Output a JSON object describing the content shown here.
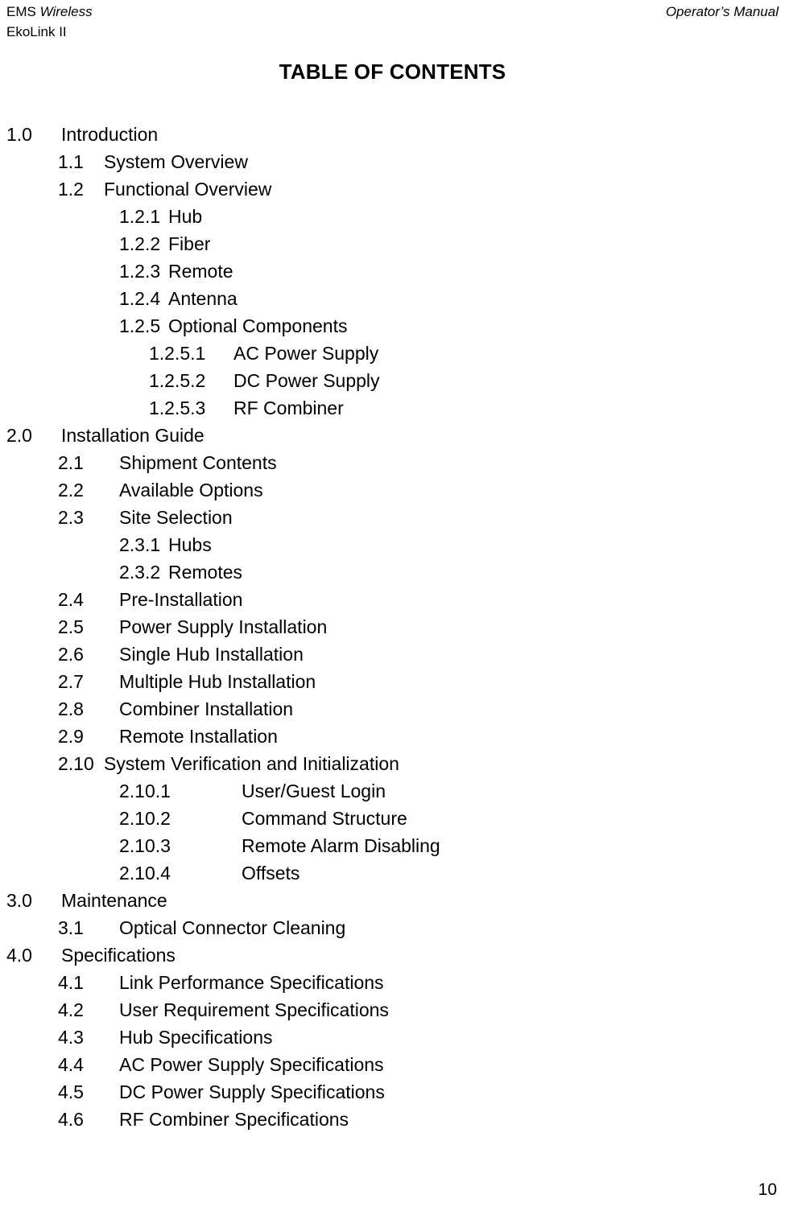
{
  "header": {
    "left_line1_regular": "EMS ",
    "left_line1_italic": "Wireless",
    "left_line2": "EkoLink II",
    "right": "Operator’s Manual"
  },
  "title": "TABLE OF CONTENTS",
  "toc": {
    "entries": [
      {
        "level": 1,
        "number": "1.0",
        "label": "Introduction"
      },
      {
        "level": 2,
        "number": "1.1",
        "label": "System Overview",
        "variant": "tight"
      },
      {
        "level": 2,
        "number": "1.2",
        "label": "Functional Overview",
        "variant": "tight"
      },
      {
        "level": 3,
        "number": "1.2.1",
        "label": "Hub"
      },
      {
        "level": 3,
        "number": "1.2.2",
        "label": "Fiber"
      },
      {
        "level": 3,
        "number": "1.2.3",
        "label": "Remote"
      },
      {
        "level": 3,
        "number": "1.2.4",
        "label": "Antenna"
      },
      {
        "level": 3,
        "number": "1.2.5",
        "label": "Optional Components"
      },
      {
        "level": 4,
        "number": "1.2.5.1",
        "label": "AC Power Supply"
      },
      {
        "level": 4,
        "number": "1.2.5.2",
        "label": "DC Power Supply"
      },
      {
        "level": 4,
        "number": "1.2.5.3",
        "label": "RF Combiner"
      },
      {
        "level": 1,
        "number": "2.0",
        "label": "Installation Guide"
      },
      {
        "level": 2,
        "number": "2.1",
        "label": "Shipment Contents"
      },
      {
        "level": 2,
        "number": "2.2",
        "label": "Available Options"
      },
      {
        "level": 2,
        "number": "2.3",
        "label": "Site Selection"
      },
      {
        "level": 3,
        "number": "2.3.1",
        "label": "Hubs"
      },
      {
        "level": 3,
        "number": "2.3.2",
        "label": "Remotes"
      },
      {
        "level": 2,
        "number": "2.4",
        "label": "Pre-Installation"
      },
      {
        "level": 2,
        "number": "2.5",
        "label": "Power Supply Installation"
      },
      {
        "level": 2,
        "number": "2.6",
        "label": "Single Hub Installation"
      },
      {
        "level": 2,
        "number": "2.7",
        "label": "Multiple Hub Installation"
      },
      {
        "level": 2,
        "number": "2.8",
        "label": "Combiner Installation"
      },
      {
        "level": 2,
        "number": "2.9",
        "label": "Remote Installation"
      },
      {
        "level": 2,
        "number": "2.10",
        "label": "System Verification and Initialization",
        "variant": "tight"
      },
      {
        "level": 3,
        "number": "2.10.1",
        "label": "User/Guest Login",
        "variant": "wide"
      },
      {
        "level": 3,
        "number": "2.10.2",
        "label": "Command Structure",
        "variant": "wide"
      },
      {
        "level": 3,
        "number": "2.10.3",
        "label": "Remote Alarm Disabling",
        "variant": "wide"
      },
      {
        "level": 3,
        "number": "2.10.4",
        "label": "Offsets",
        "variant": "wide"
      },
      {
        "level": 1,
        "number": "3.0",
        "label": "Maintenance"
      },
      {
        "level": 2,
        "number": "3.1",
        "label": "Optical Connector Cleaning"
      },
      {
        "level": 1,
        "number": "4.0",
        "label": "Specifications"
      },
      {
        "level": 2,
        "number": "4.1",
        "label": "Link Performance Specifications"
      },
      {
        "level": 2,
        "number": "4.2",
        "label": "User Requirement Specifications"
      },
      {
        "level": 2,
        "number": "4.3",
        "label": "Hub Specifications"
      },
      {
        "level": 2,
        "number": "4.4",
        "label": "AC Power Supply Specifications"
      },
      {
        "level": 2,
        "number": "4.5",
        "label": "DC Power Supply Specifications"
      },
      {
        "level": 2,
        "number": "4.6",
        "label": "RF Combiner Specifications"
      }
    ]
  },
  "page_number": "10"
}
